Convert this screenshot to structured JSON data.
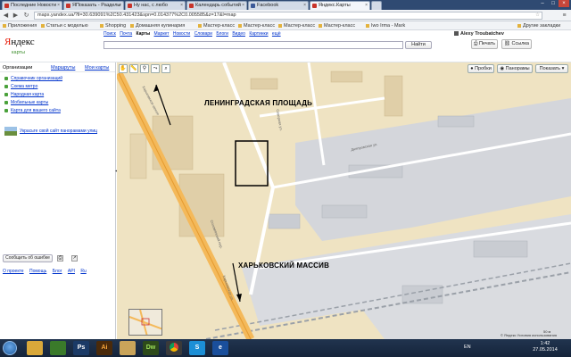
{
  "browser": {
    "tabs": [
      {
        "label": "Последние Новости",
        "active": false
      },
      {
        "label": "ЯПоказать - Разделы",
        "active": false
      },
      {
        "label": "Ну нас, с любо",
        "active": false
      },
      {
        "label": "Календарь событий",
        "active": false
      },
      {
        "label": "Facebook",
        "active": false
      },
      {
        "label": "Яндекс.Карты",
        "active": true
      }
    ],
    "url": "maps.yandex.ua/?ll=30.639091%2C50.431423&spn=0.014377%2C0.005585&z=17&l=map",
    "bookmarks": [
      "Приложения",
      "Статьи с моделью",
      "Shopping",
      "Домашняя кулинария",
      "Мастер-класс",
      "Мастер-класс",
      "Мастер-класс",
      "Мастер-класс",
      "Iwo Irma - Mark",
      "Другие закладки"
    ]
  },
  "yandex": {
    "logo": "Яндекс",
    "logo_y": "Я",
    "logo_rest": "ндекс",
    "logo_sub": "карты",
    "services": [
      "Поиск",
      "Почта",
      "Карты",
      "Маркет",
      "Новости",
      "Словари",
      "Блоги",
      "Видео",
      "Картинки",
      "ещё"
    ],
    "current_service": "Карты",
    "user": "Alexy Troubatchev",
    "search_placeholder": "",
    "search_button": "Найти",
    "print_button": "Печать",
    "link_button": "Ссылка"
  },
  "left_panel": {
    "tabs": [
      "Организации",
      "Маршруты",
      "Мои карты"
    ],
    "links": [
      "Справочник организаций",
      "Схема метро",
      "Народная карта",
      "Мобильные карты",
      "Карта для вашего сайта"
    ],
    "panorama_link": "Украсьте свой сайт панорамами улиц",
    "report_button": "Сообщить об ошибке",
    "footer": [
      "О проекте",
      "Помощь",
      "Блог",
      "API",
      "Ru"
    ]
  },
  "map": {
    "tools": [
      "hand-icon",
      "ruler-icon",
      "pin-icon",
      "route-icon",
      "magnifier-icon"
    ],
    "buttons": {
      "traffic": "Пробки",
      "panoramas": "Панорамы",
      "layers": "Показать"
    },
    "label_leningrad": "ЛЕНИНГРАДСКАЯ ПЛОЩАДЬ",
    "label_kharkiv": "ХАРЬКОВСКИЙ МАССИВ",
    "streets": [
      "Харьковское шоссе",
      "Соломянский пер.",
      "Северная ул.",
      "Днепровская ул.",
      "Харьковская ул."
    ],
    "copyright": "© Яндекс  Условия использования",
    "scale": "50 м",
    "colors": {
      "background": "#efe3c2",
      "main_road": "#f4b95a",
      "railway": "#9aa0a8",
      "industrial": "#d4d6db",
      "highlight": "#000000"
    }
  },
  "taskbar": {
    "apps": [
      {
        "name": "explorer",
        "label": "",
        "color": "#d9a83a"
      },
      {
        "name": "media",
        "label": "",
        "color": "#3a7a2a"
      },
      {
        "name": "photoshop",
        "label": "Ps",
        "color": "#1b3a66"
      },
      {
        "name": "illustrator",
        "label": "Ai",
        "color": "#4a2a0a"
      },
      {
        "name": "files",
        "label": "",
        "color": "#c9a45a"
      },
      {
        "name": "dreamweaver",
        "label": "Dw",
        "color": "#2d4a1a"
      },
      {
        "name": "chrome",
        "label": "",
        "color": "#3a3a3a"
      },
      {
        "name": "skype",
        "label": "S",
        "color": "#1c8fd6"
      },
      {
        "name": "ie",
        "label": "e",
        "color": "#1a4f9c"
      }
    ],
    "language": "EN",
    "time": "1:42",
    "date": "27.05.2014"
  }
}
